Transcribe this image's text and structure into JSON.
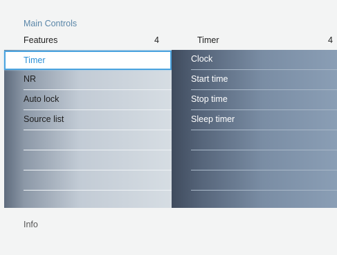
{
  "breadcrumb": "Main Controls",
  "left_panel": {
    "title": "Features",
    "count": "4",
    "selected": "Timer",
    "items": [
      "NR",
      "Auto lock",
      "Source list"
    ]
  },
  "right_panel": {
    "title": "Timer",
    "count": "4",
    "items": [
      "Clock",
      "Start time",
      "Stop time",
      "Sleep timer"
    ]
  },
  "info": "Info",
  "colors": {
    "selection_border": "#4aa3df",
    "selection_text": "#2a8fd6",
    "breadcrumb": "#5a86a8"
  }
}
